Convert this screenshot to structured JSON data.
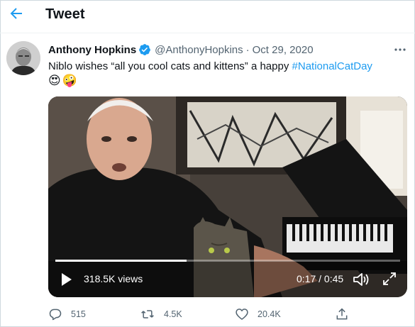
{
  "header": {
    "title": "Tweet",
    "back_icon": "arrow-left-icon",
    "accent_color": "#1d9bf0"
  },
  "tweet": {
    "author_name": "Anthony Hopkins",
    "verified_icon": "verified-badge-icon",
    "handle": "@AnthonyHopkins",
    "separator": "·",
    "date": "Oct 29, 2020",
    "more_icon": "more-horizontal-icon",
    "text_before": "Niblo wishes “all you cool cats and kittens” a happy ",
    "hashtag": "#NationalCatDay",
    "emojis": [
      "😍",
      "🤪"
    ]
  },
  "video": {
    "views": "318.5K views",
    "time": "0:17 / 0:45",
    "progress": 0.38,
    "play_icon": "play-icon",
    "volume_icon": "volume-icon",
    "fullscreen_icon": "expand-icon"
  },
  "actions": {
    "reply_count": "515",
    "retweet_count": "4.5K",
    "like_count": "20.4K",
    "reply_icon": "reply-icon",
    "retweet_icon": "retweet-icon",
    "like_icon": "heart-icon",
    "share_icon": "share-icon"
  }
}
